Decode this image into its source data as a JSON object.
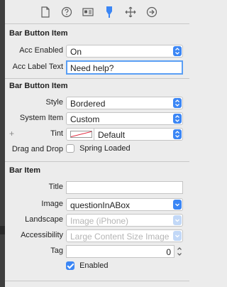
{
  "sections": {
    "bar_button_item_accessibility": {
      "title": "Bar Button Item",
      "acc_enabled_label": "Acc Enabled",
      "acc_enabled_value": "On",
      "acc_label_text_label": "Acc Label Text",
      "acc_label_text_value": "Need help?"
    },
    "bar_button_item": {
      "title": "Bar Button Item",
      "style_label": "Style",
      "style_value": "Bordered",
      "system_item_label": "System Item",
      "system_item_value": "Custom",
      "tint_label": "Tint",
      "tint_value": "Default",
      "tint_swatch_color": "#e0253b",
      "drag_drop_label": "Drag and Drop",
      "spring_loaded_label": "Spring Loaded",
      "spring_loaded_checked": false
    },
    "bar_item": {
      "title": "Bar Item",
      "title_label": "Title",
      "title_value": "",
      "image_label": "Image",
      "image_value": "questionInABox",
      "landscape_label": "Landscape",
      "landscape_placeholder": "Image (iPhone)",
      "accessibility_label": "Accessibility",
      "accessibility_placeholder": "Large Content Size Image",
      "tag_label": "Tag",
      "tag_value": "0",
      "enabled_label": "Enabled",
      "enabled_checked": true
    }
  },
  "toolbar": {
    "icons": [
      "file-inspector-icon",
      "quick-help-icon",
      "identity-inspector-icon",
      "attributes-inspector-icon",
      "size-inspector-icon",
      "connections-inspector-icon"
    ],
    "active_icon": "attributes-inspector-icon",
    "active_color": "#3b86f5"
  }
}
